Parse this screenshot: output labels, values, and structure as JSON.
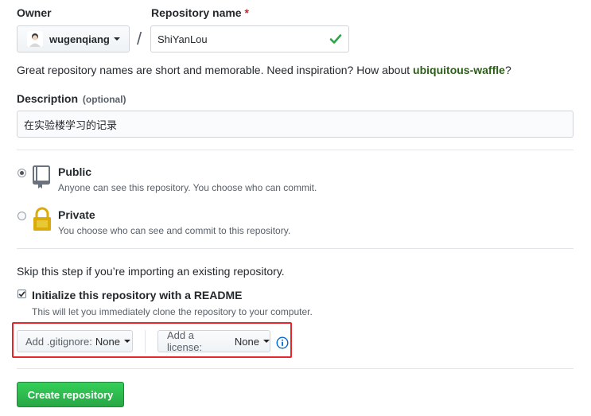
{
  "owner": {
    "label": "Owner",
    "value": "wugenqiang"
  },
  "repo_name": {
    "label": "Repository name",
    "required_mark": "*",
    "value": "ShiYanLou"
  },
  "separator": "/",
  "hint": {
    "text": "Great repository names are short and memorable. Need inspiration? How about",
    "suggestion": "ubiquitous-waffle",
    "suffix": "?"
  },
  "description": {
    "label": "Description",
    "optional": "(optional)",
    "value": "在实验楼学习的记录"
  },
  "visibility": {
    "public": {
      "title": "Public",
      "desc": "Anyone can see this repository. You choose who can commit.",
      "selected": true
    },
    "private": {
      "title": "Private",
      "desc": "You choose who can see and commit to this repository.",
      "selected": false
    }
  },
  "skip_text": "Skip this step if you’re importing an existing repository.",
  "readme": {
    "checked": true,
    "label": "Initialize this repository with a README",
    "desc": "This will let you immediately clone the repository to your computer."
  },
  "gitignore": {
    "prefix": "Add .gitignore:",
    "value": "None"
  },
  "license": {
    "prefix": "Add a license:",
    "value": "None"
  },
  "create_button": "Create repository",
  "colors": {
    "accent_green": "#28a745",
    "highlight_red": "#e5262b",
    "link_green": "#2c5e1a"
  }
}
